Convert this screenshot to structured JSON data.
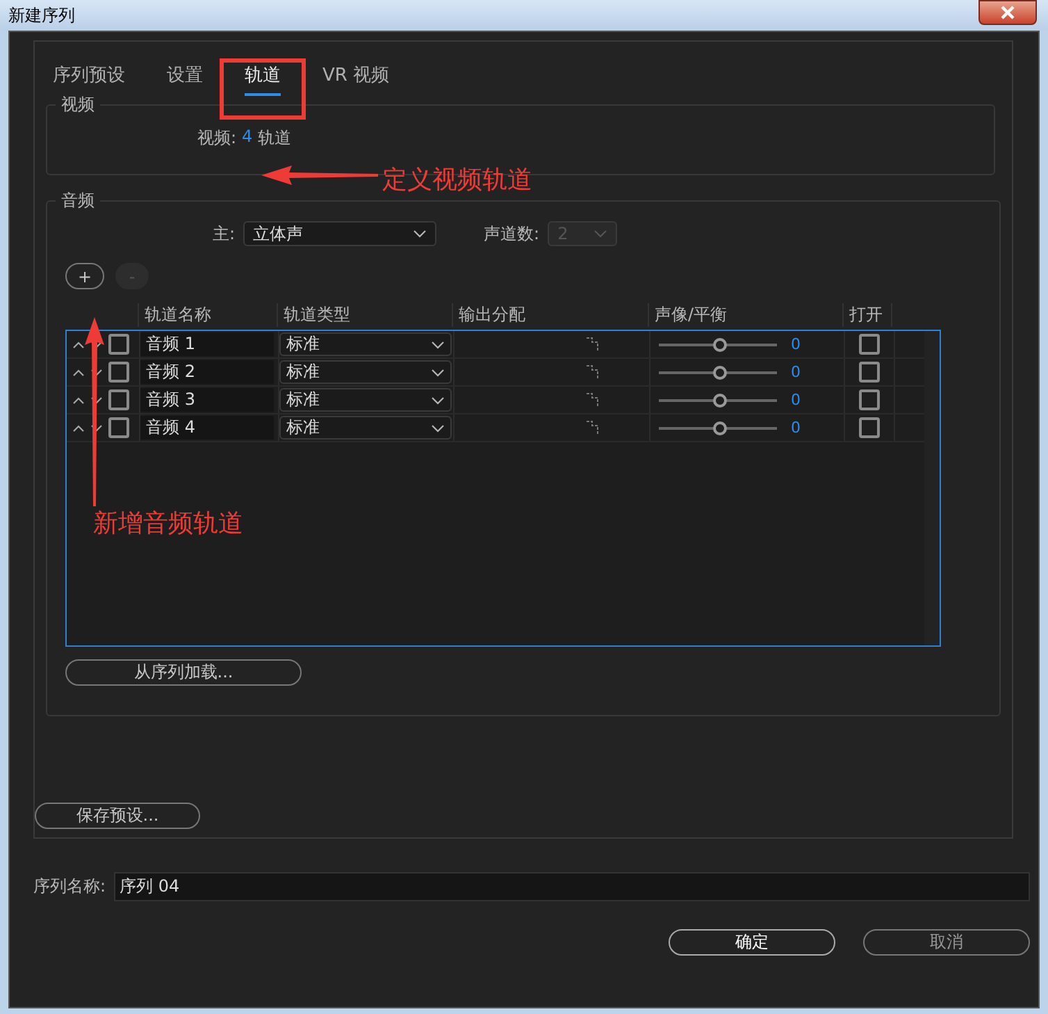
{
  "window": {
    "title": "新建序列"
  },
  "tabs": [
    {
      "label": "序列预设",
      "selected": false
    },
    {
      "label": "设置",
      "selected": false
    },
    {
      "label": "轨道",
      "selected": true
    },
    {
      "label": "VR 视频",
      "selected": false
    }
  ],
  "video": {
    "legend": "视频",
    "label": "视频:",
    "count": "4",
    "unit": "轨道"
  },
  "audio": {
    "legend": "音频",
    "master_label": "主:",
    "master_value": "立体声",
    "channels_label": "声道数:",
    "channels_value": "2",
    "channels_disabled": true,
    "add_button": "+",
    "remove_button": "-",
    "remove_disabled": true,
    "columns": [
      "轨道名称",
      "轨道类型",
      "输出分配",
      "声像/平衡",
      "打开"
    ],
    "tracks": [
      {
        "name": "音频 1",
        "type": "标准",
        "checked": false,
        "level": 0.5,
        "pan": "0",
        "open": false
      },
      {
        "name": "音频 2",
        "type": "标准",
        "checked": false,
        "level": 0.5,
        "pan": "0",
        "open": false
      },
      {
        "name": "音频 3",
        "type": "标准",
        "checked": false,
        "level": 0.5,
        "pan": "0",
        "open": false
      },
      {
        "name": "音频 4",
        "type": "标准",
        "checked": false,
        "level": 0.5,
        "pan": "0",
        "open": false
      }
    ],
    "load_button": "从序列加载..."
  },
  "save_preset": "保存预设...",
  "sequence_name": {
    "label": "序列名称:",
    "value": "序列 04"
  },
  "buttons": [
    {
      "label": "确定",
      "default": true
    },
    {
      "label": "取消",
      "default": false
    }
  ],
  "annotations": [
    {
      "text": "定义视频轨道"
    },
    {
      "text": "新增音频轨道"
    }
  ]
}
